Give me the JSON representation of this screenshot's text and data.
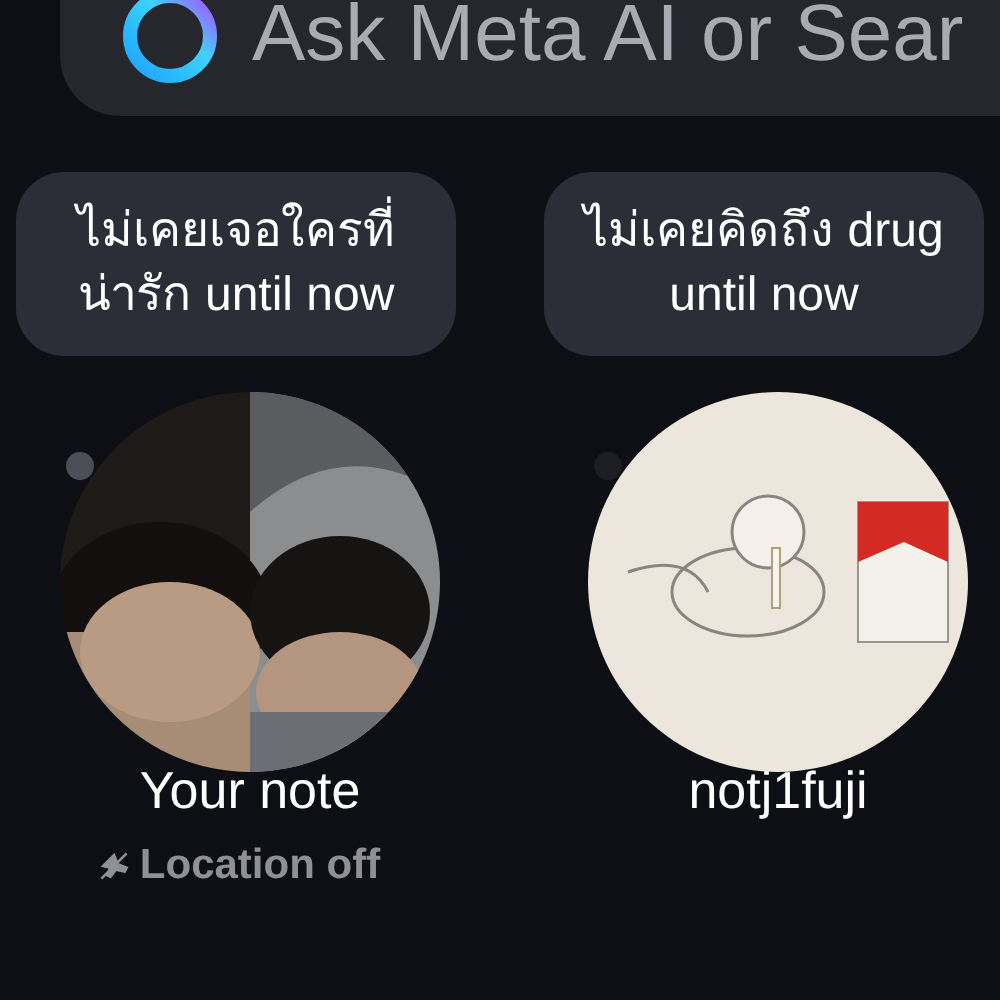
{
  "search": {
    "placeholder": "Ask Meta AI or Sear"
  },
  "notes": [
    {
      "kind": "own",
      "text": "ไม่เคยเจอใครที่น่ารัก until now",
      "name": "Your note",
      "location": "Location off"
    },
    {
      "kind": "friend",
      "text": "ไม่เคยคิดถึง drug until now",
      "name": "notj1fuji"
    }
  ]
}
